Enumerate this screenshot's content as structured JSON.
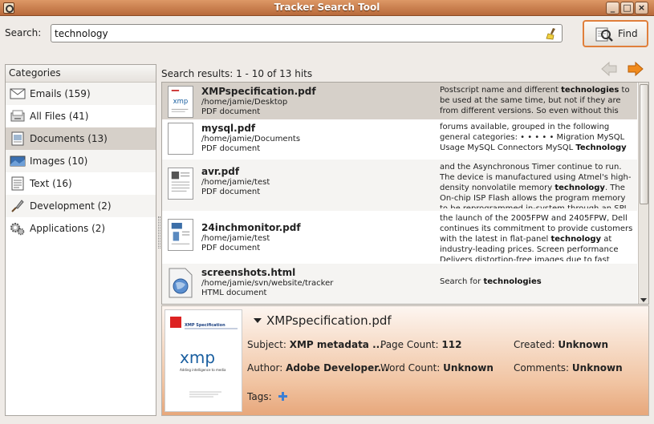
{
  "window": {
    "title": "Tracker Search Tool",
    "minimize": "_",
    "maximize": "□",
    "close": "×"
  },
  "search": {
    "label": "Search:",
    "value": "technology",
    "find_label": "Find"
  },
  "categories": {
    "header": "Categories",
    "items": [
      {
        "label": "Emails (159)",
        "icon": "email-icon"
      },
      {
        "label": "All Files (41)",
        "icon": "files-icon"
      },
      {
        "label": "Documents (13)",
        "icon": "document-icon"
      },
      {
        "label": "Images (10)",
        "icon": "image-icon"
      },
      {
        "label": "Text (16)",
        "icon": "text-icon"
      },
      {
        "label": "Development (2)",
        "icon": "development-icon"
      },
      {
        "label": "Applications (2)",
        "icon": "applications-icon"
      }
    ],
    "selected": 2
  },
  "results_header": "Search results: 1 - 10 of 13 hits",
  "results": [
    {
      "name": "XMPspecification.pdf",
      "path": "/home/jamie/Desktop",
      "kind": "PDF document",
      "snippet_parts": [
        "Postscript name and different ",
        "technologies",
        " to be used at the same time, but not if they are from different versions. So even without this data for a"
      ]
    },
    {
      "name": "mysql.pdf",
      "path": "/home/jamie/Documents",
      "kind": "PDF document",
      "snippet_parts": [
        "forums available, grouped in the following general categories: • • • • • Migration MySQL Usage MySQL Connectors MySQL ",
        "Technology",
        ""
      ]
    },
    {
      "name": "avr.pdf",
      "path": "/home/jamie/test",
      "kind": "PDF document",
      "snippet_parts": [
        "and the Asynchronous Timer continue to run. The device is manufactured using Atmel's high-density nonvolatile memory ",
        "technology",
        ". The On-chip ISP Flash allows the program memory to be reprogrammed in-system through an SPI serial"
      ]
    },
    {
      "name": "24inchmonitor.pdf",
      "path": "/home/jamie/test",
      "kind": "PDF document",
      "snippet_parts": [
        "the launch of the 2005FPW and 2405FPW, Dell continues its commitment to provide customers with the latest in flat-panel ",
        "technology",
        " at industry-leading prices. Screen performance Delivers distortion-free images due to fast"
      ]
    },
    {
      "name": "screenshots.html",
      "path": "/home/jamie/svn/website/tracker",
      "kind": "HTML document",
      "snippet_parts": [
        "Search for ",
        "technologies",
        ""
      ]
    }
  ],
  "details": {
    "title": "XMPspecification.pdf",
    "subject_label": "Subject:",
    "subject": "XMP metadata ...",
    "author_label": "Author:",
    "author": "Adobe Developer...",
    "page_count_label": "Page Count:",
    "page_count": "112",
    "word_count_label": "Word Count:",
    "word_count": "Unknown",
    "created_label": "Created:",
    "created": "Unknown",
    "comments_label": "Comments:",
    "comments": "Unknown",
    "tags_label": "Tags:",
    "preview": {
      "heading": "XMP Specification",
      "logo": "xmp",
      "tagline": "Adding intelligence to media"
    }
  }
}
